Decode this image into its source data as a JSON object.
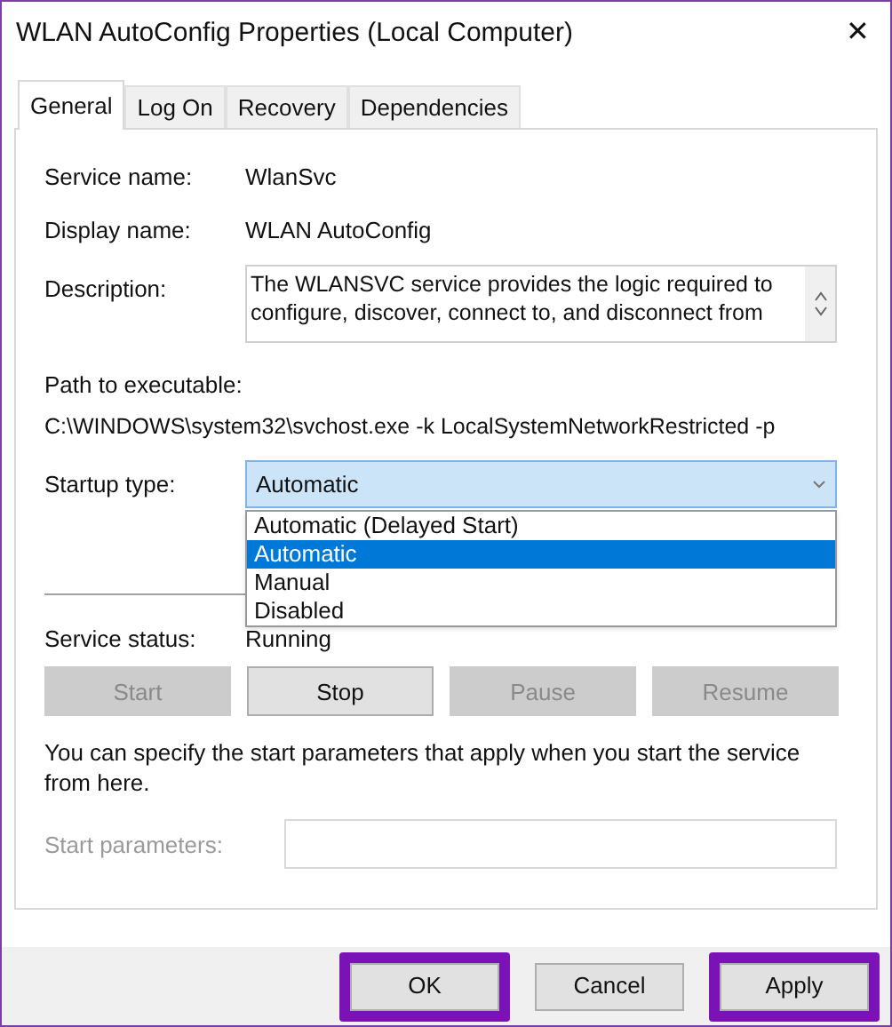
{
  "window": {
    "title": "WLAN AutoConfig Properties (Local Computer)",
    "close": "✕"
  },
  "tabs": [
    {
      "label": "General",
      "selected": true
    },
    {
      "label": "Log On",
      "selected": false
    },
    {
      "label": "Recovery",
      "selected": false
    },
    {
      "label": "Dependencies",
      "selected": false
    }
  ],
  "service_name": {
    "label": "Service name:",
    "value": "WlanSvc"
  },
  "display_name": {
    "label": "Display name:",
    "value": "WLAN AutoConfig"
  },
  "description": {
    "label": "Description:",
    "value": "The WLANSVC service provides the logic required to configure, discover, connect to, and disconnect from"
  },
  "path": {
    "label": "Path to executable:",
    "value": "C:\\WINDOWS\\system32\\svchost.exe -k LocalSystemNetworkRestricted -p"
  },
  "startup_type": {
    "label": "Startup type:",
    "value": "Automatic",
    "expanded": true,
    "options": [
      {
        "label": "Automatic (Delayed Start)",
        "selected": false
      },
      {
        "label": "Automatic",
        "selected": true
      },
      {
        "label": "Manual",
        "selected": false
      },
      {
        "label": "Disabled",
        "selected": false
      }
    ]
  },
  "service_status": {
    "label": "Service status:",
    "value": "Running"
  },
  "service_buttons": [
    {
      "label": "Start",
      "disabled": true
    },
    {
      "label": "Stop",
      "disabled": false
    },
    {
      "label": "Pause",
      "disabled": true
    },
    {
      "label": "Resume",
      "disabled": true
    }
  ],
  "hint": "You can specify the start parameters that apply when you start the service from here.",
  "start_parameters": {
    "label": "Start parameters:",
    "disabled": true
  },
  "dialog_buttons": [
    {
      "label": "OK",
      "highlighted": true
    },
    {
      "label": "Cancel",
      "highlighted": false
    },
    {
      "label": "Apply",
      "highlighted": true
    }
  ]
}
